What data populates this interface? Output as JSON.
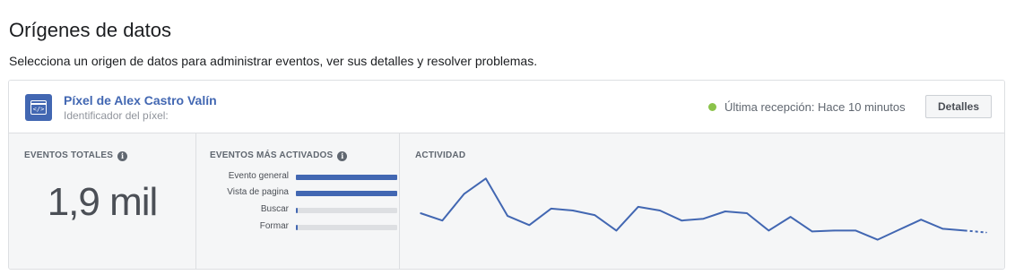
{
  "header": {
    "title": "Orígenes de datos",
    "subtitle": "Selecciona un origen de datos para administrar eventos, ver sus detalles y resolver problemas."
  },
  "pixel": {
    "name": "Píxel de Alex Castro Valín",
    "id_label": "Identificador del píxel:",
    "icon": "pixel-code-icon",
    "status_color": "#8bc34a",
    "status_text": "Última recepción: Hace 10 minutos",
    "details_label": "Detalles"
  },
  "stats": {
    "total_label": "EVENTOS TOTALES",
    "total_value": "1,9 mil",
    "top_label": "EVENTOS MÁS ACTIVADOS",
    "activity_label": "ACTIVIDAD",
    "info_icon": "i",
    "top_events": [
      {
        "name": "Evento general",
        "fraction": 1.0
      },
      {
        "name": "Vista de pagina",
        "fraction": 1.0
      },
      {
        "name": "Buscar",
        "fraction": 0.02
      },
      {
        "name": "Formar",
        "fraction": 0.02
      }
    ]
  },
  "chart_data": {
    "type": "line",
    "title": "",
    "xlabel": "",
    "ylabel": "",
    "color": "#4267b2",
    "series": [
      {
        "values": [
          48,
          40,
          69,
          86,
          45,
          35,
          53,
          51,
          46,
          29,
          55,
          51,
          40,
          42,
          50,
          48,
          29,
          44,
          28,
          29,
          29,
          19,
          30,
          41,
          31,
          29,
          27
        ],
        "dashed_from_index": 25
      }
    ],
    "ylim": [
      0,
      100
    ],
    "grid": false,
    "legend": "none"
  },
  "colors": {
    "accent": "#4267b2",
    "panel_background": "#f5f6f7",
    "border": "#dddfe2"
  }
}
